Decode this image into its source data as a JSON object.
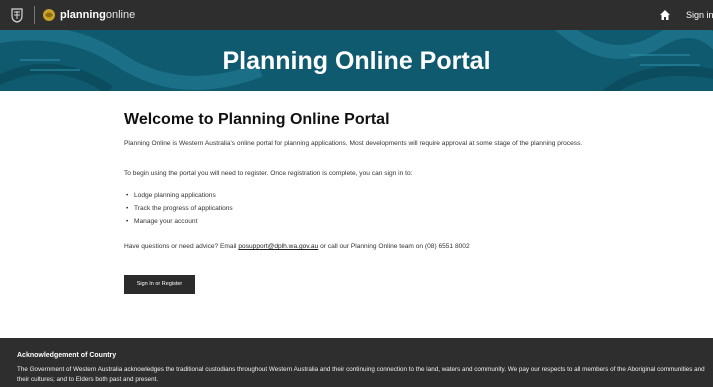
{
  "topbar": {
    "brand_bold": "planning",
    "brand_light": "online",
    "signin": "Sign in",
    "icons": {
      "crest": "crest-icon",
      "logo": "planning-logo-icon",
      "home": "home-icon"
    }
  },
  "hero": {
    "title": "Planning Online Portal",
    "color": "#0f5a6f"
  },
  "main": {
    "heading": "Welcome to Planning Online Portal",
    "intro": "Planning Online is Western Australia's online portal for planning applications. Most developments will require approval at some stage of the planning process.",
    "register_text": "To begin using the portal you will need to register. Once registration is complete, you can sign in to:",
    "list": [
      "Lodge planning applications",
      "Track the progress of applications",
      "Manage your account"
    ],
    "contact_prefix": "Have questions or need advice? Email ",
    "contact_email": "posupport@dplh.wa.gov.au",
    "contact_suffix": " or call our Planning Online team on (08) 6551 8002",
    "button_label": "Sign In or Register"
  },
  "footer": {
    "title": "Acknowledgement of Country",
    "text": "The Government of Western Australia acknowledges the traditional custodians throughout Western Australia and their continuing connection to the land, waters and community. We pay our respects to all members of the Aboriginal communities and their cultures; and to Elders both past and present."
  }
}
